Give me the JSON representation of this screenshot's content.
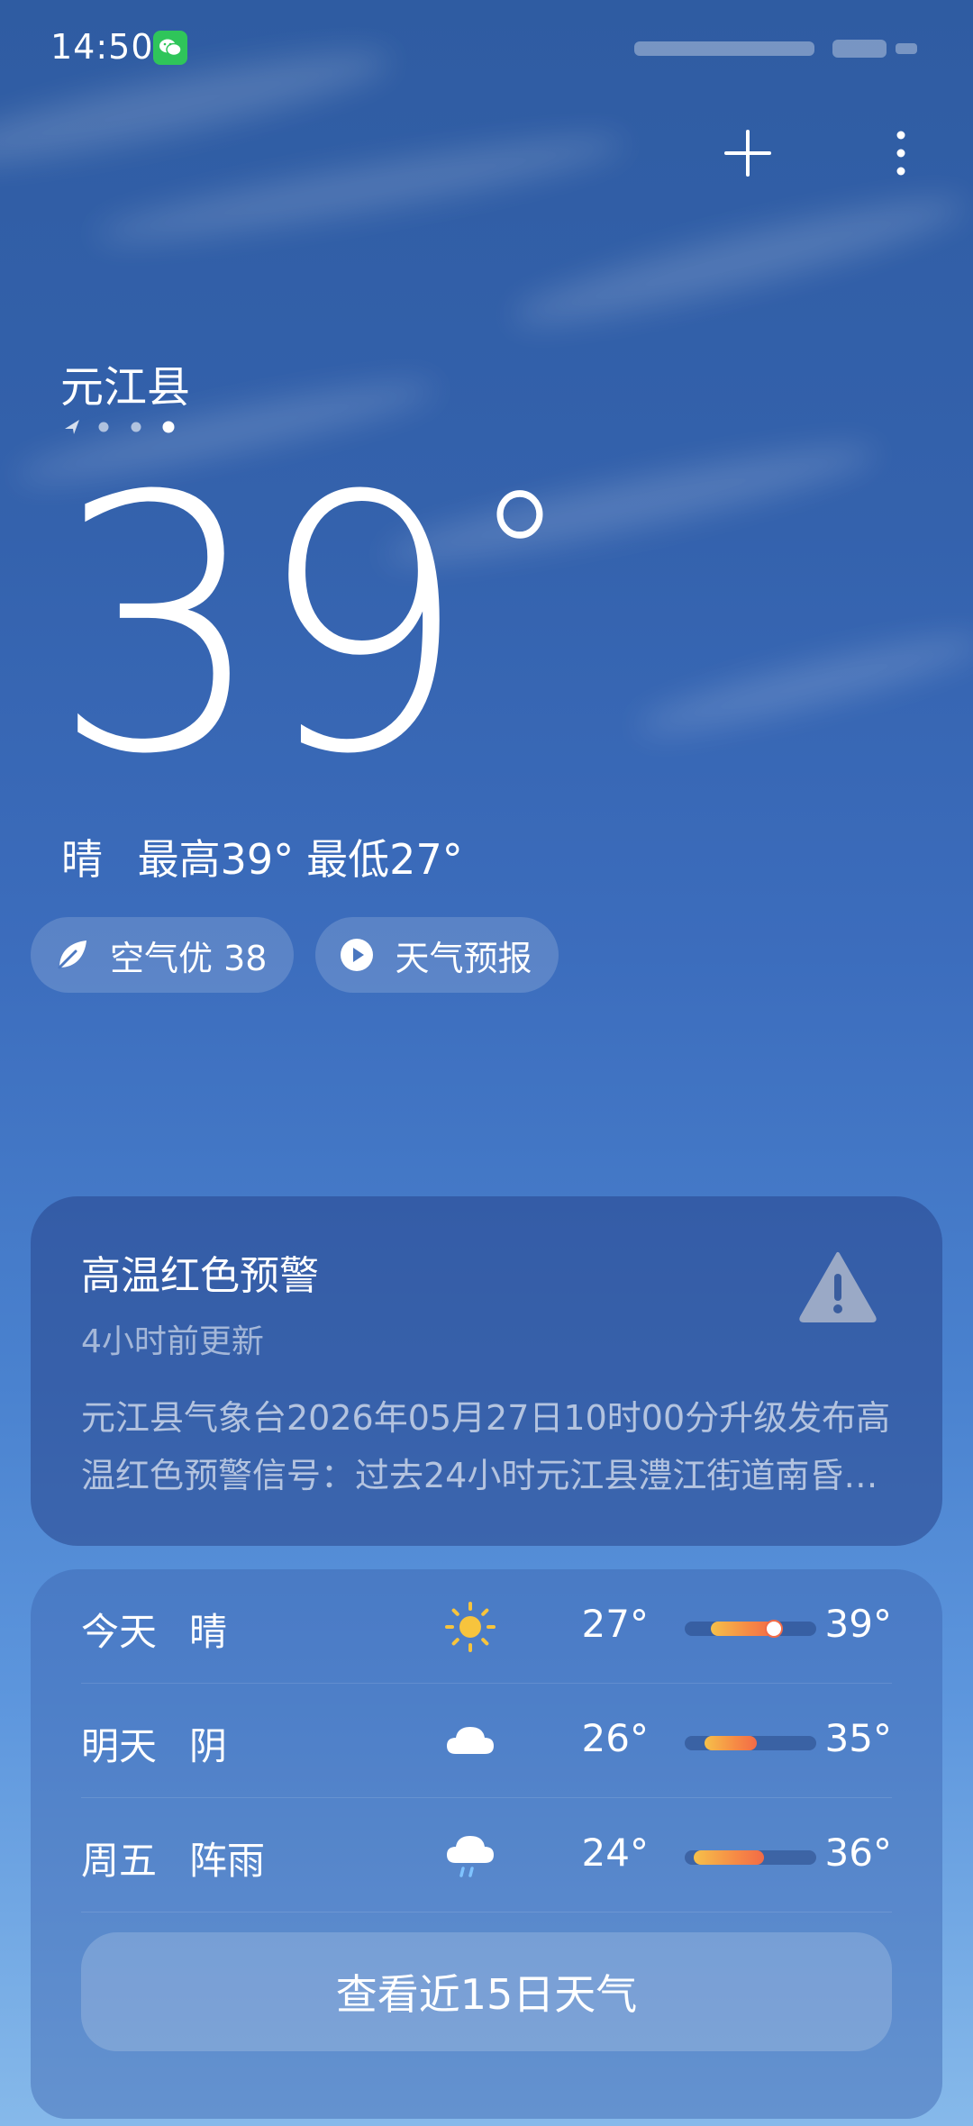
{
  "status_bar": {
    "time": "14:50",
    "notification_icon": "wechat-icon"
  },
  "header": {
    "add_icon": "plus-icon",
    "more_icon": "more-vertical-icon"
  },
  "location": {
    "city": "元江县",
    "page_indicator": {
      "count": 4,
      "current_index": 3,
      "first_is_location": true
    }
  },
  "current": {
    "temperature": "39",
    "degree_symbol": "°",
    "condition": "晴",
    "high_label": "最高39°",
    "low_label": "最低27°"
  },
  "pills": {
    "air": {
      "icon": "leaf-icon",
      "label": "空气优 38"
    },
    "forecast_video": {
      "icon": "play-icon",
      "label": "天气预报"
    }
  },
  "alert": {
    "title": "高温红色预警",
    "updated": "4小时前更新",
    "body": "元江县气象台2026年05月27日10时00分升级发布高温红色预警信号：过去24小时元江县澧江街道南昏…",
    "icon": "warning-icon"
  },
  "forecast": {
    "rows": [
      {
        "day": "今天",
        "condition": "晴",
        "icon": "sun-icon",
        "low": "27°",
        "high": "39°",
        "bar_start": 0.2,
        "bar_end": 0.68,
        "show_current": true,
        "current_pos": 0.68
      },
      {
        "day": "明天",
        "condition": "阴",
        "icon": "cloud-icon",
        "low": "26°",
        "high": "35°",
        "bar_start": 0.15,
        "bar_end": 0.55,
        "show_current": false
      },
      {
        "day": "周五",
        "condition": "阵雨",
        "icon": "rain-cloud-icon",
        "low": "24°",
        "high": "36°",
        "bar_start": 0.07,
        "bar_end": 0.6,
        "show_current": false
      }
    ],
    "button_label": "查看近15日天气"
  },
  "colors": {
    "bar_gradient_start": "#f6c04a",
    "bar_gradient_end": "#f26b47",
    "sun": "#f7c43d",
    "wechat": "#2fc55a"
  }
}
